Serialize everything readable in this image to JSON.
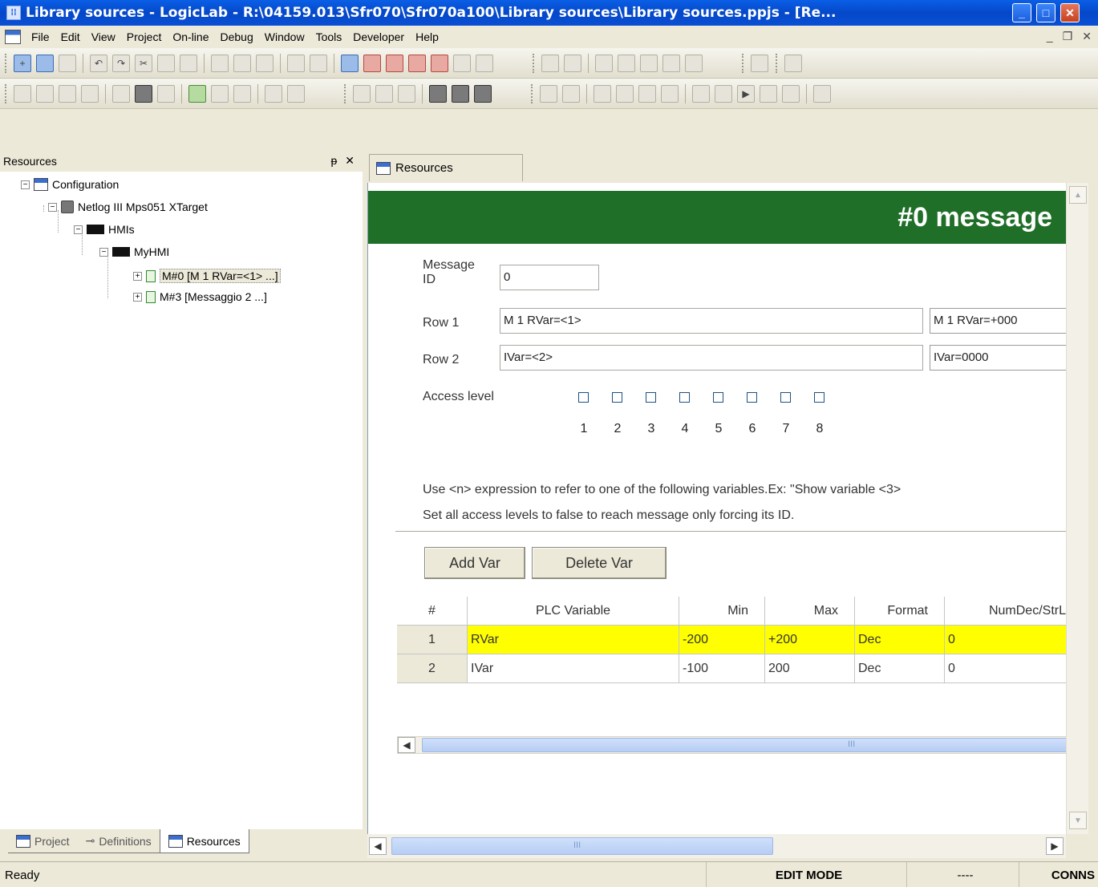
{
  "window": {
    "title": "Library sources - LogicLab - R:\\04159.013\\Sfr070\\Sfr070a100\\Library sources\\Library sources.ppjs - [Re...",
    "app_icon": "logiclab-icon",
    "minimize": "_",
    "maximize": "□",
    "close": "✕"
  },
  "menu": {
    "items": [
      "File",
      "Edit",
      "View",
      "Project",
      "On-line",
      "Debug",
      "Window",
      "Tools",
      "Developer",
      "Help"
    ],
    "mdi_minimize": "_",
    "mdi_restore": "❐",
    "mdi_close": "✕"
  },
  "resources_pane": {
    "title": "Resources",
    "pin": "ᵽ",
    "close": "✕",
    "tree": [
      {
        "label": "Configuration",
        "icon": "configuration-icon"
      },
      {
        "label": "Netlog III Mps051 XTarget",
        "icon": "target-icon"
      },
      {
        "label": "HMIs",
        "icon": "hmi-folder-icon"
      },
      {
        "label": "MyHMI",
        "icon": "hmi-icon"
      },
      {
        "label": "M#0 [M 1 RVar=<1> ...]",
        "icon": "message-icon",
        "selected": true
      },
      {
        "label": "M#3 [Messaggio 2 ...]",
        "icon": "message-icon"
      }
    ],
    "bottom_tabs": [
      "Project",
      "Definitions",
      "Resources"
    ]
  },
  "document": {
    "tab_label": "Resources",
    "banner_title": "#0 message",
    "message_id_label": "Message ID",
    "message_id_label_line1": "Message",
    "message_id_label_line2": "ID",
    "message_id_value": "0",
    "row1_label": "Row 1",
    "row1_value": "M 1 RVar=<1>",
    "row1_preview": "M 1 RVar=+000",
    "row2_label": "Row 2",
    "row2_value": "IVar=<2>",
    "row2_preview": "IVar=0000",
    "access_level_label": "Access level",
    "access_levels": [
      "1",
      "2",
      "3",
      "4",
      "5",
      "6",
      "7",
      "8"
    ],
    "hint1": "Use <n> expression to refer to one of the following variables.Ex: \"Show variable <3>",
    "hint2": "Set all access levels to false to reach message only forcing its ID.",
    "add_var": "Add Var",
    "delete_var": "Delete Var",
    "columns": [
      "#",
      "PLC Variable",
      "Min",
      "Max",
      "Format",
      "NumDec/StrL"
    ],
    "rows": [
      {
        "num": "1",
        "var": "RVar",
        "min": "-200",
        "max": "+200",
        "format": "Dec",
        "numdec": "0",
        "highlighted": true
      },
      {
        "num": "2",
        "var": "IVar",
        "min": "-100",
        "max": "200",
        "format": "Dec",
        "numdec": "0",
        "highlighted": false
      }
    ],
    "hscroll_grip": "III"
  },
  "statusbar": {
    "ready": "Ready",
    "mode": "EDIT MODE",
    "dashes": "----",
    "conn": "CONNS"
  },
  "colors": {
    "banner_green": "#1f6f28",
    "highlight_yellow": "#ffff00",
    "titlebar_blue": "#0548c9"
  }
}
